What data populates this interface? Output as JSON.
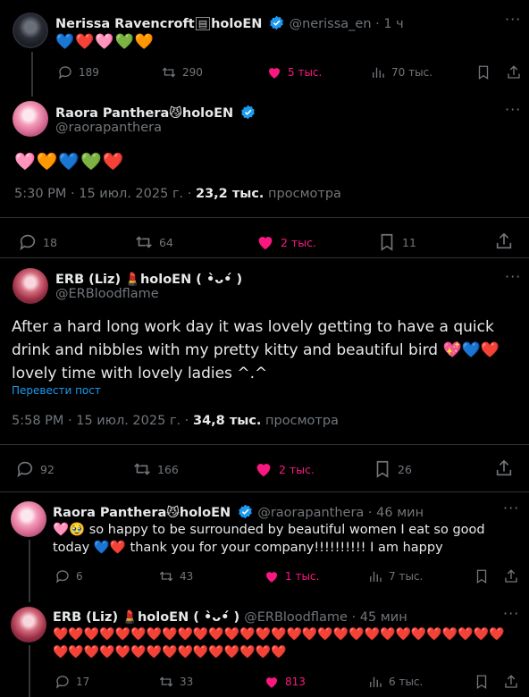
{
  "tweet1": {
    "name": "Nerissa Ravencroft",
    "name_suffix": "holoEN",
    "handle_time": "@nerissa_en · 1 ч",
    "emojis": "💙❤️🩷💚🧡",
    "actions": {
      "replies": "189",
      "reposts": "290",
      "likes": "5 тыс.",
      "views": "70 тыс."
    }
  },
  "tweet2": {
    "name": "Raora Panthera",
    "name_suffix": "holoEN",
    "handle": "@raorapanthera",
    "emojis": "🩷🧡💙💚❤️",
    "timestamp": "5:30 PM · 15 июл. 2025 г. · ",
    "views_count": "23,2 тыс.",
    "views_label": " просмотра",
    "actions": {
      "replies": "18",
      "reposts": "64",
      "likes": "2 тыс.",
      "bookmarks": "11"
    }
  },
  "tweet3": {
    "name": "ERB (Liz)",
    "name_suffix": "holoEN ( •̀ᴗ•́ )",
    "handle": "@ERBloodflame",
    "text": "After a hard long work day it was lovely getting to have a quick drink and nibbles with my pretty kitty and beautiful bird 💖💙❤️ lovely time with lovely ladies ^.^",
    "translate": "Перевести пост",
    "timestamp": "5:58 PM · 15 июл. 2025 г. · ",
    "views_count": "34,8 тыс.",
    "views_label": " просмотра",
    "actions": {
      "replies": "92",
      "reposts": "166",
      "likes": "2 тыс.",
      "bookmarks": "26"
    }
  },
  "tweet4": {
    "name": "Raora Panthera",
    "name_suffix": "holoEN",
    "handle_time": "@raorapanthera · 46 мин",
    "text": "🩷🥹 so happy to be surrounded by beautiful women I eat so good today 💙❤️ thank you for your company!!!!!!!!!! I am happy",
    "actions": {
      "replies": "6",
      "reposts": "43",
      "likes": "1 тыс.",
      "views": "7 тыс."
    }
  },
  "tweet5": {
    "name": "ERB (Liz)",
    "name_suffix": "holoEN ( •̀ᴗ•́ )",
    "handle_time": "@ERBloodflame · 45 мин",
    "hearts": "❤️❤️❤️❤️❤️❤️❤️❤️❤️❤️❤️❤️❤️❤️❤️❤️❤️❤️❤️❤️❤️❤️❤️❤️❤️❤️❤️❤️❤️❤️❤️❤️❤️❤️❤️❤️❤️❤️❤️❤️❤️❤️❤️❤️",
    "actions": {
      "replies": "17",
      "reposts": "33",
      "likes": "813",
      "views": "6 тыс."
    }
  },
  "colors": {
    "accent": "#1d9bf0",
    "like": "#f91880",
    "muted": "#71767b",
    "bg": "#000000"
  }
}
